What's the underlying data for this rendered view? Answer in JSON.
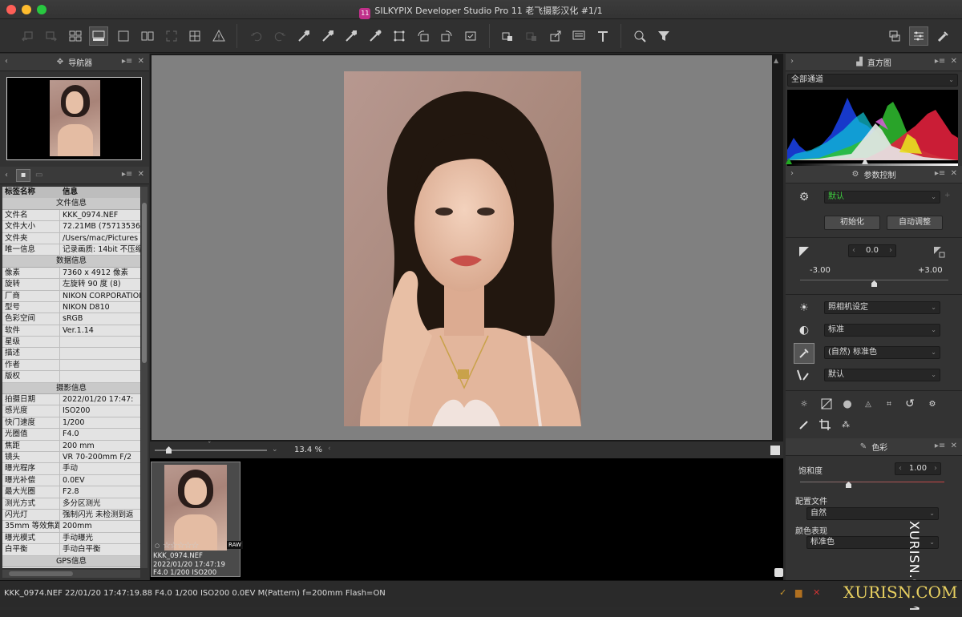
{
  "window": {
    "title": "SILKYPIX Developer Studio Pro 11 老飞摄影汉化   #1/1",
    "app_badge": "11"
  },
  "navigator": {
    "title": "导航器"
  },
  "info_panel": {
    "col_key": "标签名称",
    "col_val": "信息",
    "sections": [
      {
        "title": "文件信息",
        "rows": [
          [
            "文件名",
            "KKK_0974.NEF"
          ],
          [
            "文件大小",
            "72.21MB (75713536"
          ],
          [
            "文件夹",
            "/Users/mac/Pictures"
          ],
          [
            "唯一信息",
            "记录画质: 14bit 不压缩"
          ]
        ]
      },
      {
        "title": "数据信息",
        "rows": [
          [
            "像素",
            "7360 x 4912 像素"
          ],
          [
            "旋转",
            "左旋转 90 度 (8)"
          ],
          [
            "厂商",
            "NIKON CORPORATION"
          ],
          [
            "型号",
            "NIKON D810"
          ],
          [
            "色彩空间",
            "sRGB"
          ],
          [
            "软件",
            "Ver.1.14"
          ],
          [
            "星级",
            ""
          ],
          [
            "描述",
            ""
          ],
          [
            "作者",
            ""
          ],
          [
            "版权",
            ""
          ]
        ]
      },
      {
        "title": "摄影信息",
        "rows": [
          [
            "拍摄日期",
            "2022/01/20 17:47:"
          ],
          [
            "感光度",
            "ISO200"
          ],
          [
            "快门速度",
            "1/200"
          ],
          [
            "光圈值",
            "F4.0"
          ],
          [
            "焦距",
            "200 mm"
          ],
          [
            "镜头",
            "VR 70-200mm F/2"
          ],
          [
            "曝光程序",
            "手动"
          ],
          [
            "曝光补偿",
            "0.0EV"
          ],
          [
            "最大光圈",
            "F2.8"
          ],
          [
            "测光方式",
            "多分区测光"
          ],
          [
            "闪光灯",
            "强制闪光 未检测到返"
          ],
          [
            "35mm 等效焦距",
            "200mm"
          ],
          [
            "曝光模式",
            "手动曝光"
          ],
          [
            "白平衡",
            "手动白平衡"
          ]
        ]
      },
      {
        "title": "GPS信息",
        "rows": []
      }
    ]
  },
  "viewer": {
    "zoom": "13.4 %"
  },
  "thumbnail": {
    "filename": "KKK_0974.NEF",
    "datetime": "2022/01/20 17:47:19",
    "exposure": "F4.0 1/200 ISO200",
    "raw_badge": "RAW",
    "stars": "☆☆☆☆☆"
  },
  "histogram": {
    "title": "直方图",
    "channel": "全部通道"
  },
  "params": {
    "title": "参数控制",
    "preset": "默认",
    "init_btn": "初始化",
    "auto_btn": "自动调整",
    "exposure_value": "0.0",
    "exposure_min": "-3.00",
    "exposure_max": "+3.00",
    "wb": "照相机设定",
    "tone": "标准",
    "color": "(自然) 标准色",
    "sharp": "默认"
  },
  "color_panel": {
    "title": "色彩",
    "saturation_label": "饱和度",
    "saturation_value": "1.00",
    "profile_label": "配置文件",
    "profile_value": "自然",
    "appearance_label": "颜色表现",
    "appearance_value": "标准色"
  },
  "status": {
    "text": "KKK_0974.NEF 22/01/20 17:47:19.88 F4.0 1/200 ISO200  0.0EV M(Pattern) f=200mm Flash=ON"
  },
  "watermark": {
    "vertical": "XURISN.COM",
    "bottom": "XURISN.COM"
  },
  "colors": {
    "accent_green": "#3fd13f",
    "panel_bg": "#333333"
  }
}
